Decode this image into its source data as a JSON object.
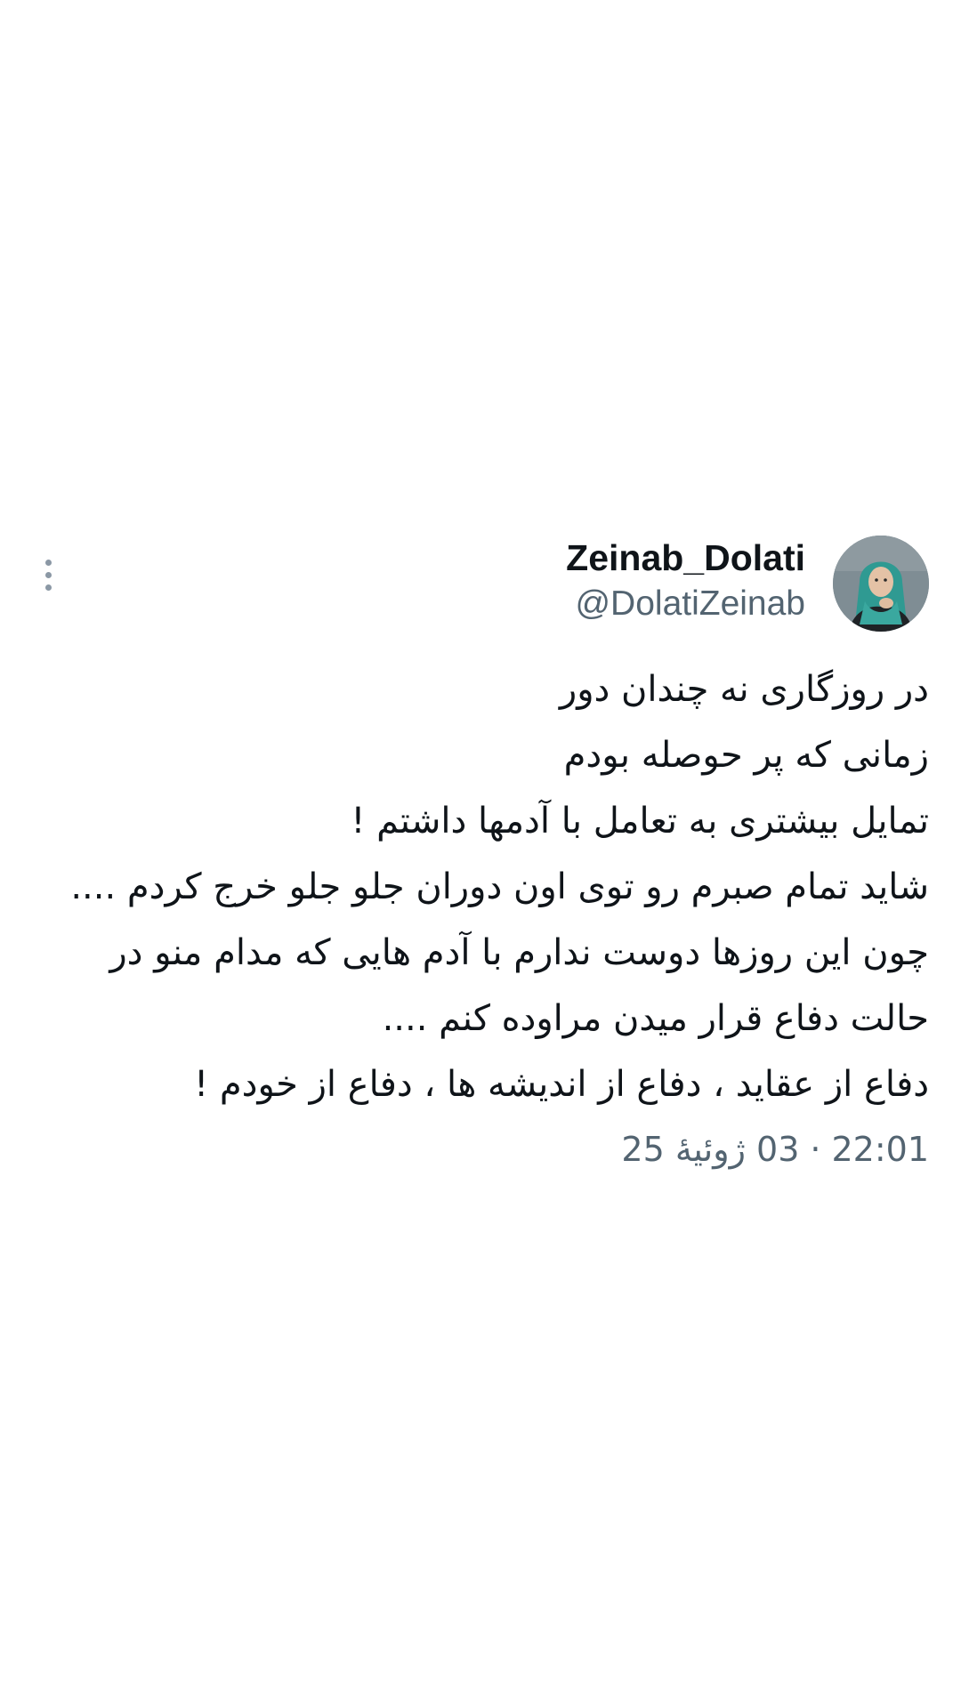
{
  "tweet": {
    "author": {
      "display_name": "Zeinab_Dolati",
      "handle": "@DolatiZeinab",
      "avatar_icon": "profile-photo"
    },
    "menu_icon": "more-vertical-icon",
    "text_lines": [
      "در روزگاری نه چندان دور",
      "زمانی که پر حوصله بودم",
      "تمایل بیشتری به تعامل با آدمها داشتم !",
      "شاید تمام صبرم رو توی اون دوران جلو جلو خرج کردم ....",
      "چون این روزها دوست ندارم با آدم هایی که مدام منو در",
      "حالت دفاع قرار میدن مراوده کنم ....",
      "دفاع از عقاید ، دفاع از اندیشه ها ، دفاع از خودم !"
    ],
    "timestamp": {
      "time": "22:01",
      "separator": "·",
      "date": "03 ژوئیهٔ 25"
    },
    "colors": {
      "primary_text": "#0f1419",
      "secondary_text": "#536471",
      "menu_dots": "#8b98a5"
    }
  }
}
